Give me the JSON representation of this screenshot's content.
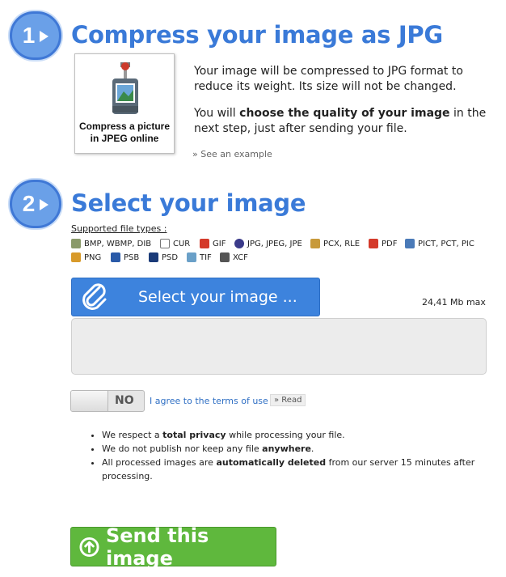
{
  "step1": {
    "number": "1",
    "title": "Compress your image as JPG",
    "thumbnail_caption": "Compress a picture in JPEG online",
    "paragraph1": "Your image will be compressed to JPG format to reduce its weight. Its size will not be changed.",
    "paragraph2_pre": "You will ",
    "paragraph2_bold": "choose the quality of your image",
    "paragraph2_post": " in the next step, just after sending your file.",
    "see_example": "» See an example"
  },
  "step2": {
    "number": "2",
    "title": "Select your image",
    "supported_label": "Supported file types :",
    "file_types": [
      {
        "label": "BMP, WBMP, DIB",
        "icon": "bmp-icon",
        "color": "#8a9a6a"
      },
      {
        "label": "CUR",
        "icon": "cursor-icon",
        "color": "#777777"
      },
      {
        "label": "GIF",
        "icon": "gif-icon",
        "color": "#d43a2a"
      },
      {
        "label": "JPG, JPEG, JPE",
        "icon": "jpg-icon",
        "color": "#3b3b8a"
      },
      {
        "label": "PCX, RLE",
        "icon": "pcx-icon",
        "color": "#c89a3a"
      },
      {
        "label": "PDF",
        "icon": "pdf-icon",
        "color": "#d43a2a"
      },
      {
        "label": "PICT, PCT, PIC",
        "icon": "pict-icon",
        "color": "#4a7ab8"
      },
      {
        "label": "PNG",
        "icon": "png-icon",
        "color": "#d89a2a"
      },
      {
        "label": "PSB",
        "icon": "psb-icon",
        "color": "#2a5aa8"
      },
      {
        "label": "PSD",
        "icon": "psd-icon",
        "color": "#1a3a78"
      },
      {
        "label": "TIF",
        "icon": "tif-icon",
        "color": "#6aa0c8"
      },
      {
        "label": "XCF",
        "icon": "xcf-icon",
        "color": "#555555"
      }
    ],
    "select_button": "Select your image ...",
    "max_size": "24,41 Mb max",
    "toggle_state": "NO",
    "agree_text": "I agree to the terms of use",
    "read_link": "» Read",
    "privacy": [
      {
        "pre": "We respect a ",
        "bold": "total privacy",
        "post": " while processing your file."
      },
      {
        "pre": "We do not publish nor keep any file ",
        "bold": "anywhere",
        "post": "."
      },
      {
        "pre": "All processed images are ",
        "bold": "automatically deleted",
        "post": " from our server 15 minutes after processing."
      }
    ],
    "send_button": "Send this image"
  },
  "colors": {
    "accent_blue": "#3a7ad8",
    "select_button": "#3d83dd",
    "send_button": "#5fb83d"
  }
}
